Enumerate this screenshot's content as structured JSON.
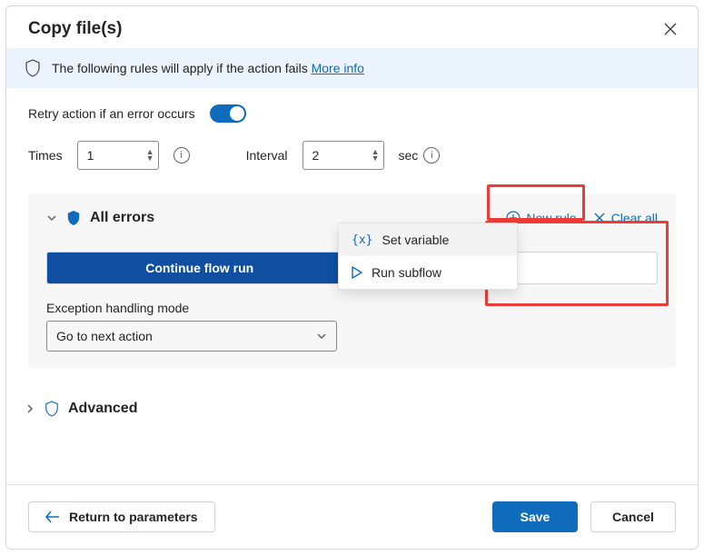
{
  "header": {
    "title": "Copy file(s)"
  },
  "info": {
    "text": "The following rules will apply if the action fails",
    "more": "More info"
  },
  "retry": {
    "label": "Retry action if an error occurs",
    "timesLabel": "Times",
    "timesValue": "1",
    "intervalLabel": "Interval",
    "intervalValue": "2",
    "unit": "sec"
  },
  "errors": {
    "title": "All errors",
    "newRule": "New rule",
    "clearAll": "Clear all",
    "continue": "Continue flow run",
    "modeLabel": "Exception handling mode",
    "modeValue": "Go to next action",
    "menu": {
      "setVariable": "Set variable",
      "runSubflow": "Run subflow"
    }
  },
  "advanced": {
    "title": "Advanced"
  },
  "footer": {
    "return": "Return to parameters",
    "save": "Save",
    "cancel": "Cancel"
  }
}
